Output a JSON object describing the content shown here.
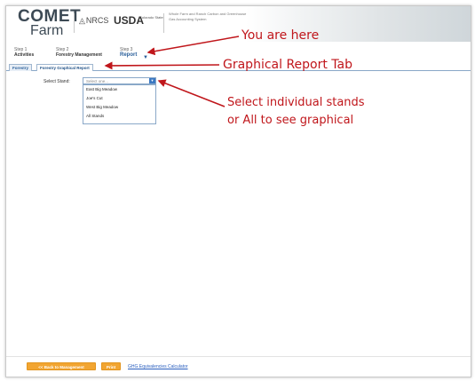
{
  "header": {
    "logo_top": "COMET",
    "logo_bottom": "Farm",
    "nrcs": "NRCS",
    "usda": "USDA",
    "csu": "Colorado State",
    "tagline": "Whole Farm and Ranch Carbon and Greenhouse Gas Accounting System"
  },
  "steps": [
    {
      "num": "Step 1",
      "label": "Activities"
    },
    {
      "num": "Step 2",
      "label": "Forestry Management"
    },
    {
      "num": "Step 3",
      "label": "Report"
    }
  ],
  "tabs": [
    {
      "label": "Forestry"
    },
    {
      "label": "Forestry Graphical Report"
    }
  ],
  "stand_select": {
    "label": "Select Stand:",
    "placeholder": "Select one...",
    "options": [
      "East Big Meadow",
      "Joe's Cut",
      "West Big Meadow",
      "All Stands"
    ]
  },
  "annotations": {
    "you_are_here": "You are here",
    "graphical_tab": "Graphical Report Tab",
    "select_stands_line1": "Select individual stands",
    "select_stands_line2": "or All to see graphical"
  },
  "footer": {
    "back_button": "<< Back to Management",
    "print_button": "Print",
    "ghg_link": "GHG Equivalencies Calculator"
  },
  "colors": {
    "accent_blue": "#2a5f9a",
    "annotation_red": "#c0161b",
    "button_orange": "#f2a531"
  }
}
